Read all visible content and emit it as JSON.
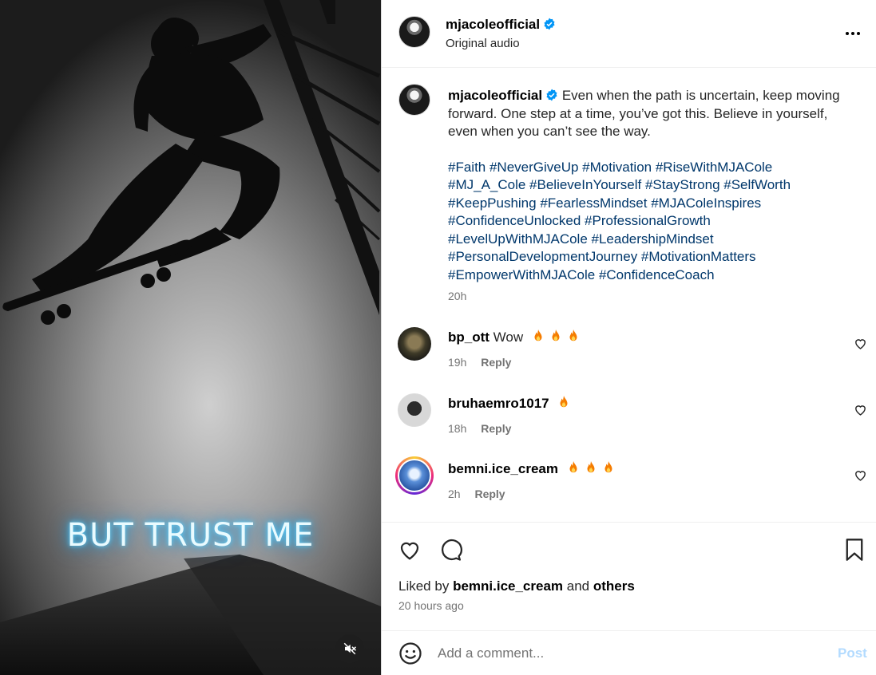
{
  "media": {
    "overlay_text": "BUT TRUST ME",
    "mute_icon": "speaker-muted-icon"
  },
  "post": {
    "author": "mjacoleofficial",
    "verified": true,
    "audio": "Original audio",
    "caption": "Even when the path is uncertain, keep moving forward. One step at a time, you’ve got this. Believe in yourself, even when you can’t see the way.",
    "hashtags": "#Faith #NeverGiveUp #Motivation #RiseWithMJACole #MJ_A_Cole #BelieveInYourself #StayStrong #SelfWorth #KeepPushing #FearlessMindset #MJAColeInspires #ConfidenceUnlocked #ProfessionalGrowth #LevelUpWithMJACole #LeadershipMindset #PersonalDevelopmentJourney #MotivationMatters #EmpowerWithMJACole #ConfidenceCoach",
    "caption_time": "20h"
  },
  "comments": [
    {
      "user": "bp_ott",
      "text": "Wow",
      "fires": 3,
      "time": "19h",
      "reply": "Reply"
    },
    {
      "user": "bruhaemro1017",
      "text": "",
      "fires": 1,
      "time": "18h",
      "reply": "Reply"
    },
    {
      "user": "bemni.ice_cream",
      "text": "",
      "fires": 3,
      "time": "2h",
      "reply": "Reply"
    }
  ],
  "footer": {
    "liked_prefix": "Liked by",
    "liked_user": "bemni.ice_cream",
    "liked_and": "and",
    "liked_others": "others",
    "post_time": "20 hours ago",
    "comment_placeholder": "Add a comment...",
    "post_label": "Post"
  },
  "colors": {
    "verified_blue": "#0095f6",
    "hashtag": "#00376b",
    "post_disabled": "#b3dbff",
    "caption_glow": "#29a9e8"
  }
}
